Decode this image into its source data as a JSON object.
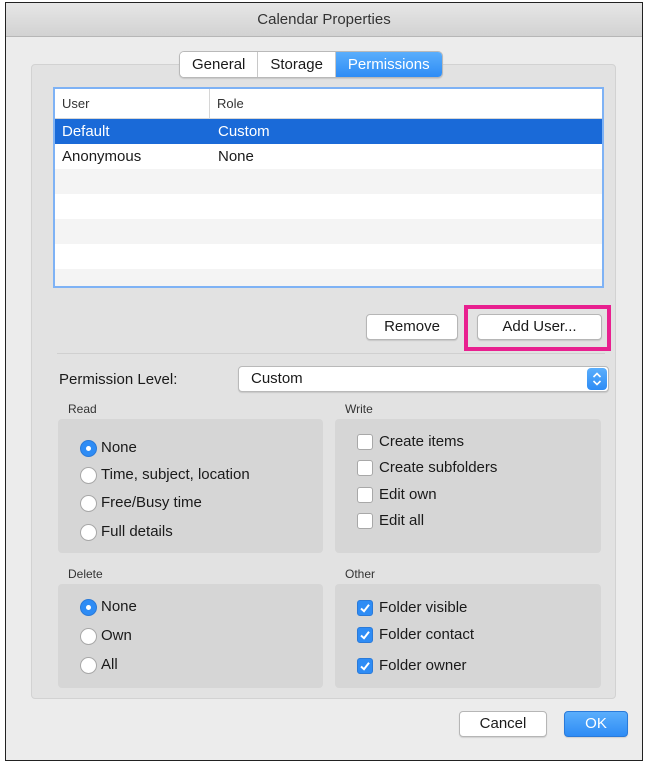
{
  "window": {
    "title": "Calendar Properties"
  },
  "tabs": [
    {
      "label": "General",
      "active": false
    },
    {
      "label": "Storage",
      "active": false
    },
    {
      "label": "Permissions",
      "active": true
    }
  ],
  "user_list": {
    "columns": [
      "User",
      "Role"
    ],
    "rows": [
      {
        "user": "Default",
        "role": "Custom",
        "selected": true
      },
      {
        "user": "Anonymous",
        "role": "None",
        "selected": false
      }
    ]
  },
  "buttons": {
    "remove": "Remove",
    "add_user": "Add User...",
    "cancel": "Cancel",
    "ok": "OK"
  },
  "permission_level": {
    "label": "Permission Level:",
    "value": "Custom"
  },
  "read": {
    "label": "Read",
    "options": [
      "None",
      "Time, subject, location",
      "Free/Busy time",
      "Full details"
    ],
    "selected": "None"
  },
  "write": {
    "label": "Write",
    "options": [
      {
        "label": "Create items",
        "checked": false
      },
      {
        "label": "Create subfolders",
        "checked": false
      },
      {
        "label": "Edit own",
        "checked": false
      },
      {
        "label": "Edit all",
        "checked": false
      }
    ]
  },
  "delete": {
    "label": "Delete",
    "options": [
      "None",
      "Own",
      "All"
    ],
    "selected": "None"
  },
  "other": {
    "label": "Other",
    "options": [
      {
        "label": "Folder visible",
        "checked": true
      },
      {
        "label": "Folder contact",
        "checked": true
      },
      {
        "label": "Folder owner",
        "checked": true
      }
    ]
  },
  "colors": {
    "accent": "#2e8cf5",
    "selection": "#1a6ad8",
    "highlight_box": "#e8208f"
  }
}
